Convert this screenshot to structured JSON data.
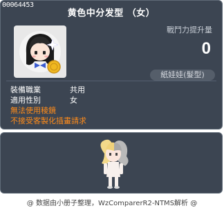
{
  "item": {
    "id": "00064453",
    "title": "黄色中分发型 （女）",
    "stat_label": "戰鬥力提升量",
    "stat_value": "0",
    "category": "紙娃娃(髮型)",
    "icon": "hair-avatar-icon"
  },
  "info": [
    {
      "label": "裝備職業",
      "value": "共用"
    },
    {
      "label": "適用性別",
      "value": "女"
    }
  ],
  "warnings": [
    "無法使用稜鏡",
    "不接受客製化插畫請求"
  ],
  "footer": "@ 数据由小册子整理，WzComparerR2-NTMS解析 @",
  "colors": {
    "panel_bg": "#3c4552",
    "panel_border": "#5f6b78",
    "warning": "#ff8c1a",
    "badge_bg": "#555e6a"
  }
}
